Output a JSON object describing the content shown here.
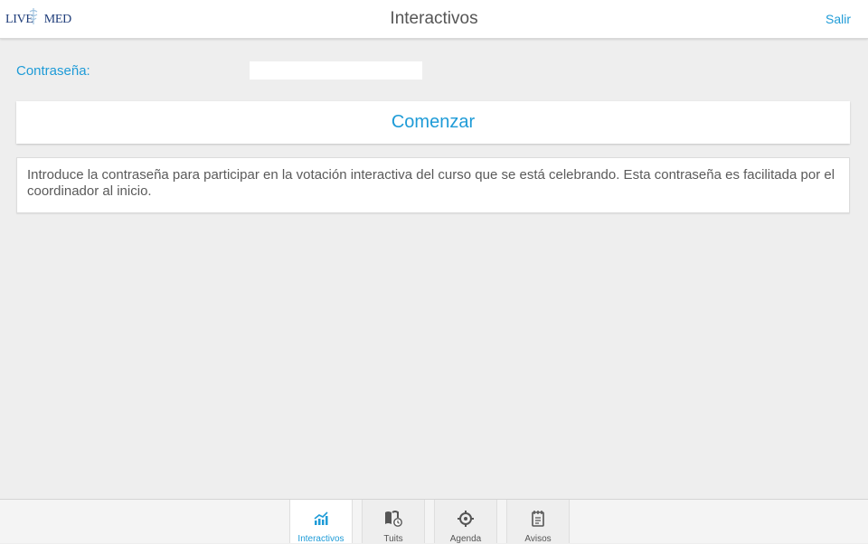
{
  "header": {
    "logo": {
      "left": "LIVE",
      "right": "MED"
    },
    "title": "Interactivos",
    "logout_label": "Salir"
  },
  "form": {
    "password_label": "Contraseña:",
    "password_value": "",
    "start_label": "Comenzar"
  },
  "info": {
    "text": "Introduce la contraseña para participar en la votación interactiva del curso que se está celebrando. Esta contraseña es facilitada por el coordinador al inicio."
  },
  "tabs": [
    {
      "label": "Interactivos",
      "icon": "chart-icon",
      "active": true
    },
    {
      "label": "Tuits",
      "icon": "book-clock-icon",
      "active": false
    },
    {
      "label": "Agenda",
      "icon": "target-icon",
      "active": false
    },
    {
      "label": "Avisos",
      "icon": "notes-icon",
      "active": false
    }
  ],
  "colors": {
    "accent": "#1e9bd7",
    "background": "#eeeeee",
    "logo": "#1f3d7a"
  }
}
